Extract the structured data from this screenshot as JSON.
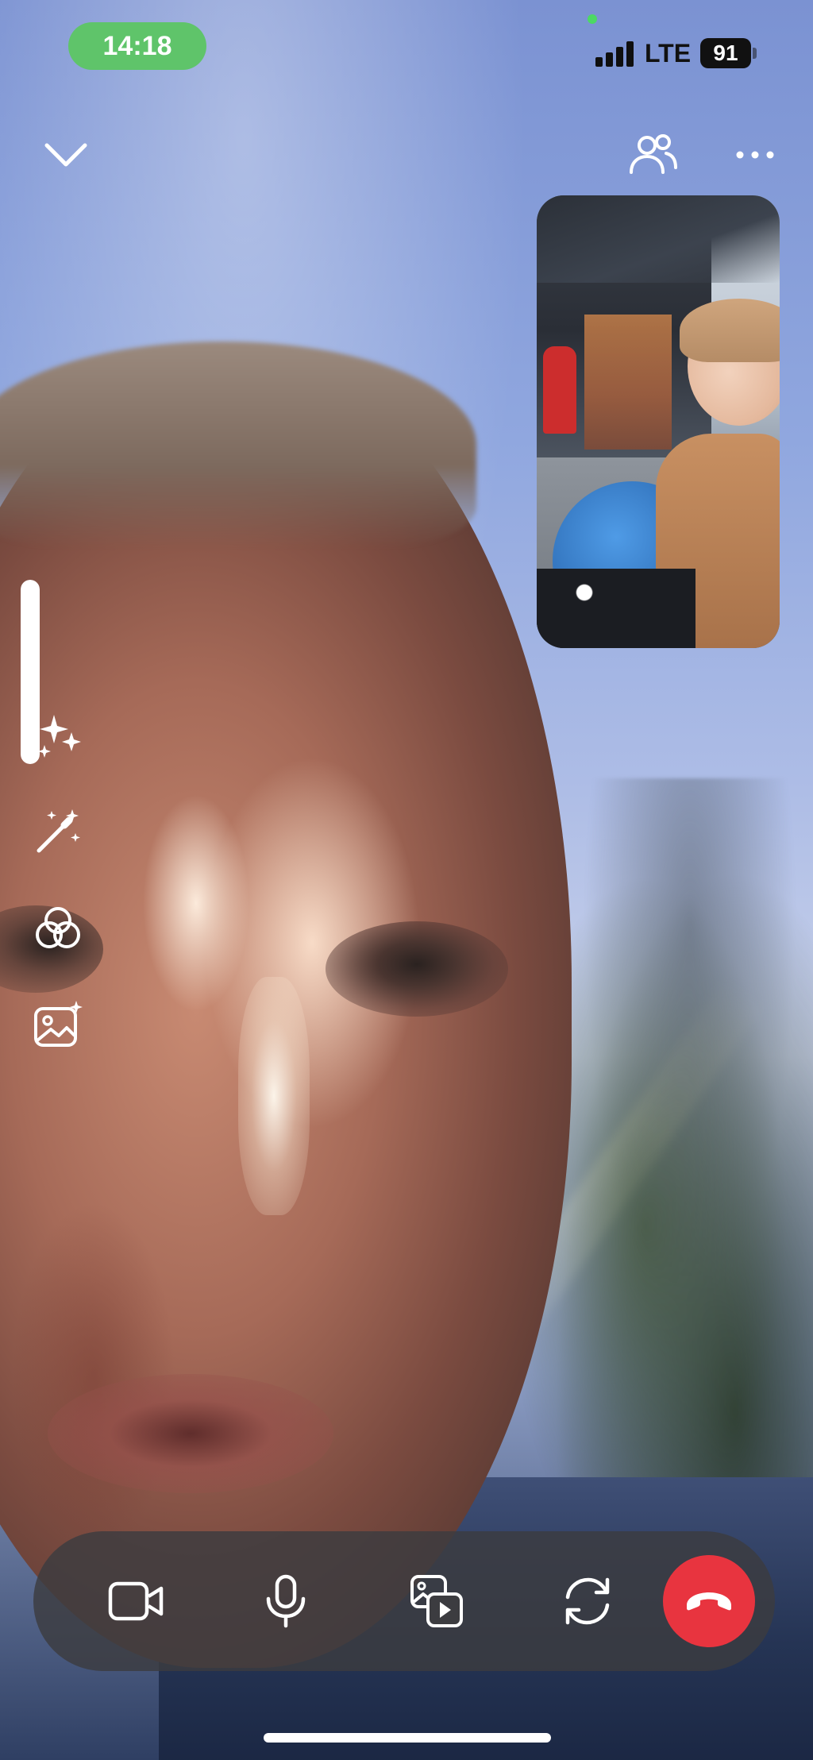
{
  "status_bar": {
    "time": "14:18",
    "network": "LTE",
    "battery": "91",
    "signal_bars": 4
  },
  "top_controls": {
    "minimize_icon": "chevron-down-icon",
    "participants_icon": "people-icon",
    "more_icon": "more-horizontal-icon"
  },
  "effects_toolbar": {
    "intensity_level": 1.0,
    "items": [
      {
        "icon": "sparkles-icon"
      },
      {
        "icon": "magic-wand-icon"
      },
      {
        "icon": "color-filters-icon"
      },
      {
        "icon": "background-image-icon"
      }
    ]
  },
  "call_controls": {
    "items": [
      {
        "icon": "video-camera-icon"
      },
      {
        "icon": "microphone-icon"
      },
      {
        "icon": "share-media-icon"
      },
      {
        "icon": "flip-camera-icon"
      },
      {
        "icon": "end-call-icon"
      }
    ],
    "end_call_color": "#e8343f"
  },
  "colors": {
    "time_pill": "#5fc46a",
    "control_bar": "#3c3c40",
    "privacy_indicator": "#4cd964"
  }
}
